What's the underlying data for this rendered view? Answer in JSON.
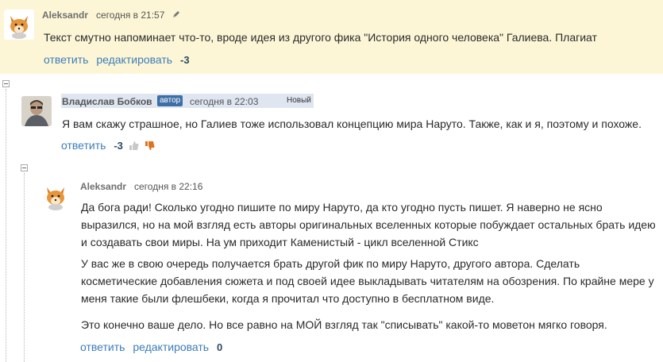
{
  "comments": [
    {
      "author": "Aleksandr",
      "time": "сегодня в 21:57",
      "text": "Текст смутно напоминает что-то, вроде идея из другого фика \"История одного человека\" Галиева. Плагиат",
      "actions": {
        "reply": "ответить",
        "edit": "редактировать",
        "score": "-3"
      },
      "avatar_icon": "fox-avatar-icon"
    },
    {
      "author": "Владислав Бобков",
      "badge": "автор",
      "time": "сегодня в 22:03",
      "new_label": "Новый",
      "text": "Я вам скажу страшное, но Галиев тоже использовал концепцию мира Наруто. Также, как и я, поэтому и похоже.",
      "actions": {
        "reply": "ответить",
        "score": "-3"
      },
      "avatar_icon": "user-photo-avatar-icon"
    },
    {
      "author": "Aleksandr",
      "time": "сегодня в 22:16",
      "paragraphs": [
        [
          "Да бога ради! Сколько угодно пишите по миру Наруто, да кто угодно пусть пишет. Я наверно не ясно",
          "выразился, но на мой взгляд есть авторы оригинальных вселенных которые побуждает остальных брать идею",
          "и создавать свои миры. На ум приходит Каменистый - цикл вселенной Стикс"
        ],
        [
          "У вас же в свою очередь получается брать другой фик по миру Наруто, другого автора. Сделать",
          "косметические добавления сюжета и под своей идее выкладывать читателям на обозрения. По крайне мере у",
          "меня такие были флешбеки, когда я прочитал что доступно в бесплатном виде."
        ],
        [
          "Это конечно ваше дело. Но все равно на МОЙ взгляд так \"списывать\" какой-то моветон мягко говоря."
        ]
      ],
      "actions": {
        "reply": "ответить",
        "edit": "редактировать",
        "score": "0"
      },
      "avatar_icon": "fox-avatar-icon"
    }
  ],
  "colors": {
    "highlight_bg": "#fcf6d6",
    "link": "#3c7dbb",
    "badge": "#3e6ea6",
    "author_highlight": "#dfe6f2"
  }
}
